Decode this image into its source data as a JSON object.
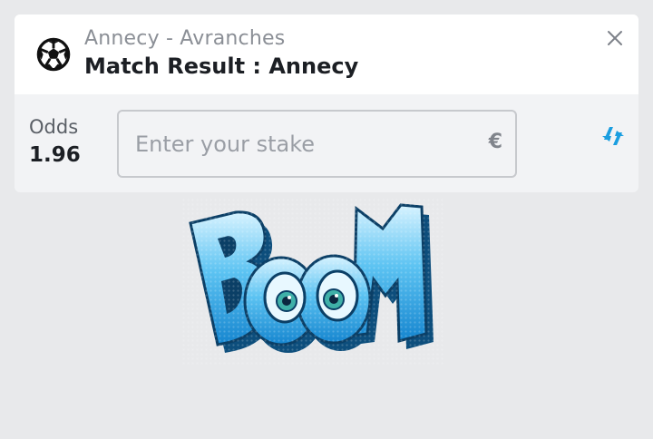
{
  "bet_slip": {
    "event": "Annecy - Avranches",
    "market": "Match Result : Annecy",
    "odds_label": "Odds",
    "odds_value": "1.96",
    "stake_placeholder": "Enter your stake",
    "currency": "€",
    "icons": {
      "sport": "soccer-ball-icon",
      "close": "close-icon",
      "swap": "swap-icon"
    },
    "accent_color": "#1a9ee0"
  },
  "sticker": {
    "text": "BOOM"
  }
}
